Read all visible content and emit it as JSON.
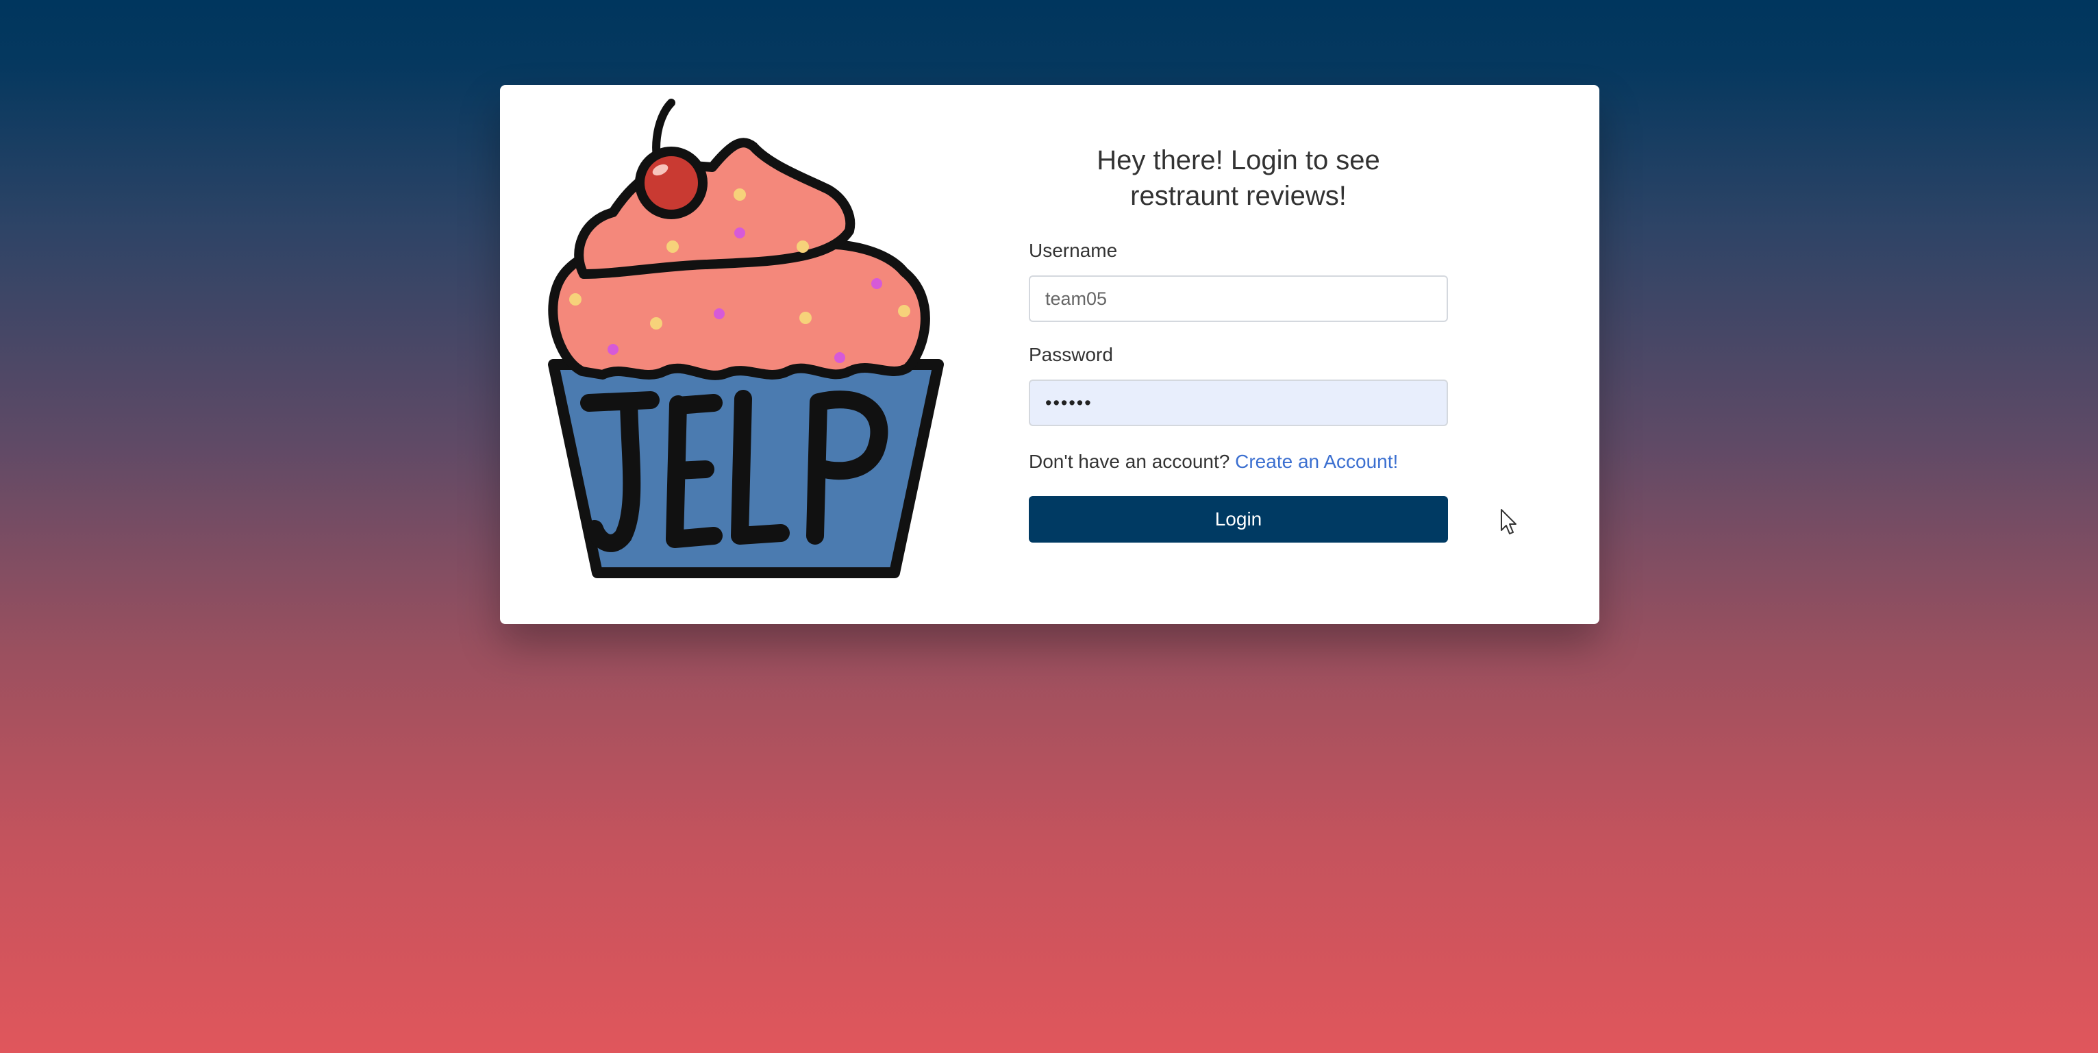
{
  "heading": {
    "line1": "Hey there! Login to see",
    "line2": "restraunt reviews!"
  },
  "logo": {
    "text": "JELP",
    "icon": "cupcake-logo-icon"
  },
  "username": {
    "label": "Username",
    "value": "team05"
  },
  "password": {
    "label": "Password",
    "value": "••••••"
  },
  "account": {
    "prompt": "Don't have an account?",
    "link_label": "Create an Account!"
  },
  "login_button": {
    "label": "Login"
  },
  "colors": {
    "primary": "#003a63",
    "link": "#3b6fd0",
    "frosting": "#f4887b",
    "wrapper": "#4b7bb0",
    "cherry": "#c93a32"
  }
}
